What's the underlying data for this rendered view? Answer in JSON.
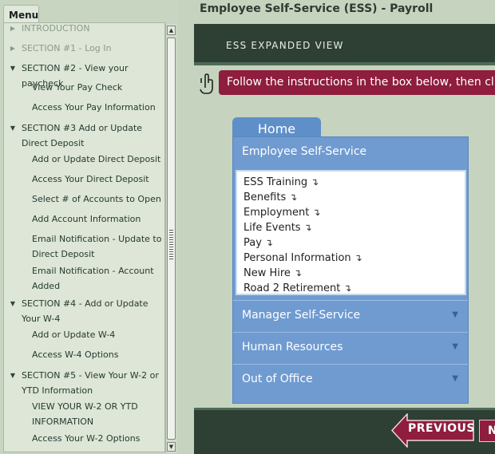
{
  "sidebar": {
    "menu_label": "Menu",
    "items": [
      {
        "label": "INTRODUCTION",
        "level": "section",
        "state": "collapsed",
        "dim": true
      },
      {
        "label": "SECTION #1 - Log In",
        "level": "section",
        "state": "collapsed",
        "dim": true
      },
      {
        "label": "SECTION #2 - View your paycheck",
        "level": "section",
        "state": "expanded"
      },
      {
        "label": "View Your Pay Check",
        "level": "sub"
      },
      {
        "label": "Access Your Pay Information",
        "level": "sub"
      },
      {
        "label": "SECTION #3 Add or Update Direct Deposit",
        "level": "section",
        "state": "expanded"
      },
      {
        "label": "Add or Update Direct Deposit",
        "level": "sub"
      },
      {
        "label": "Access Your Direct Deposit",
        "level": "sub"
      },
      {
        "label": "Select # of Accounts to Open",
        "level": "sub"
      },
      {
        "label": "Add Account Information",
        "level": "sub"
      },
      {
        "label": "Email Notification - Update to Direct Deposit",
        "level": "sub"
      },
      {
        "label": "Email Notification - Account Added",
        "level": "sub"
      },
      {
        "label": "SECTION #4 - Add or Update Your W-4",
        "level": "section",
        "state": "expanded"
      },
      {
        "label": "Add or Update W-4",
        "level": "sub"
      },
      {
        "label": "Access W-4 Options",
        "level": "sub"
      },
      {
        "label": "SECTION #5 - View Your W-2 or YTD Information",
        "level": "section",
        "state": "expanded"
      },
      {
        "label": "VIEW YOUR W-2 OR YTD INFORMATION",
        "level": "sub"
      },
      {
        "label": "Access Your W-2 Options",
        "level": "sub"
      }
    ]
  },
  "header": {
    "title": "Employee Self-Service (ESS) - Payroll",
    "banner": "ESS EXPANDED VIEW"
  },
  "instruction": "Follow the instructions in the box below, then click",
  "widget": {
    "tab_label": "Home",
    "ess_section": "Employee Self-Service",
    "ess_items": [
      "ESS Training",
      "Benefits",
      "Employment",
      "Life Events",
      "Pay",
      "Personal Information",
      "New Hire",
      "Road 2 Retirement"
    ],
    "sections": [
      "Manager Self-Service",
      "Human Resources",
      "Out of Office"
    ]
  },
  "footer": {
    "previous_label": "PREVIOUS",
    "next_label": "N"
  },
  "colors": {
    "banner": "#2e3f33",
    "instruction": "#8e1d3e",
    "widget_blue": "#6f9bd1",
    "sidebar": "#dde6d7"
  },
  "icons": {
    "section_expanded": "▼",
    "section_collapsed": "▶",
    "submenu": "↴"
  }
}
